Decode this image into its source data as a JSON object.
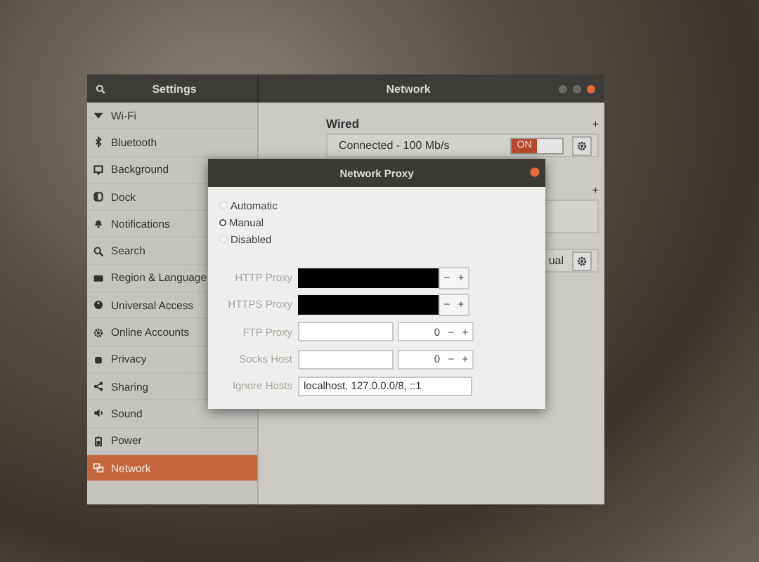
{
  "settings_window": {
    "title": "Settings",
    "panel_title": "Network",
    "sidebar": {
      "items": [
        {
          "label": "Wi-Fi",
          "selected": false
        },
        {
          "label": "Bluetooth",
          "selected": false
        },
        {
          "label": "Background",
          "selected": false
        },
        {
          "label": "Dock",
          "selected": false
        },
        {
          "label": "Notifications",
          "selected": false
        },
        {
          "label": "Search",
          "selected": false
        },
        {
          "label": "Region & Language",
          "selected": false
        },
        {
          "label": "Universal Access",
          "selected": false
        },
        {
          "label": "Online Accounts",
          "selected": false
        },
        {
          "label": "Privacy",
          "selected": false
        },
        {
          "label": "Sharing",
          "selected": false
        },
        {
          "label": "Sound",
          "selected": false
        },
        {
          "label": "Power",
          "selected": false
        },
        {
          "label": "Network",
          "selected": true
        }
      ]
    },
    "wired": {
      "heading": "Wired",
      "add": "+",
      "status": "Connected - 100 Mb/s",
      "switch": {
        "label": "ON",
        "on": true
      }
    },
    "second_section": {
      "add": "+"
    },
    "proxy_row": {
      "value": "ual"
    }
  },
  "dialog": {
    "title": "Network Proxy",
    "methods": [
      {
        "label": "Automatic",
        "selected": false
      },
      {
        "label": "Manual",
        "selected": true
      },
      {
        "label": "Disabled",
        "selected": false
      }
    ],
    "rows": [
      {
        "kind": "redacted",
        "label": "HTTP Proxy",
        "minus": "−",
        "plus": "+"
      },
      {
        "kind": "redacted",
        "label": "HTTPS Proxy",
        "minus": "−",
        "plus": "+"
      },
      {
        "kind": "host_port",
        "label": "FTP Proxy",
        "port": "0",
        "minus": "−",
        "plus": "+"
      },
      {
        "kind": "host_port",
        "label": "Socks Host",
        "port": "0",
        "minus": "−",
        "plus": "+"
      },
      {
        "kind": "text",
        "label": "Ignore Hosts",
        "value": "localhost, 127.0.0.0/8, ::1"
      }
    ]
  }
}
